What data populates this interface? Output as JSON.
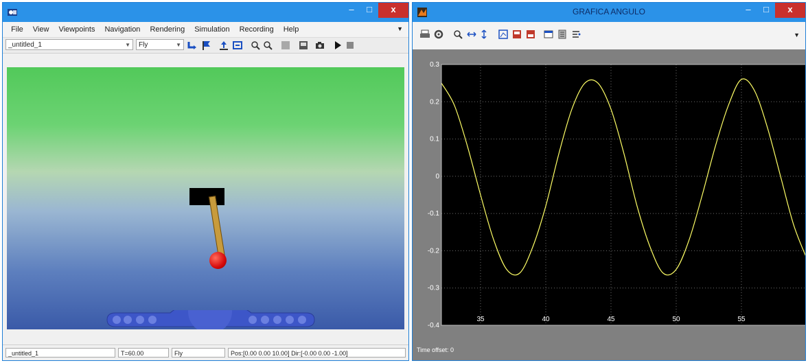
{
  "vr_window": {
    "menu": [
      "File",
      "View",
      "Viewpoints",
      "Navigation",
      "Rendering",
      "Simulation",
      "Recording",
      "Help"
    ],
    "world_combo": "_untitled_1",
    "nav_mode_combo": "Fly",
    "status": {
      "world": "_untitled_1",
      "time": "T=60.00",
      "mode": "Fly",
      "pos": "Pos:[0.00 0.00 10.00] Dir:[-0.00 0.00 -1.00]"
    }
  },
  "scope_window": {
    "title": "GRAFICA ANGULO",
    "time_offset_label": "Time offset:",
    "time_offset_value": "0"
  },
  "chart_data": {
    "type": "line",
    "title": "",
    "xlabel": "",
    "ylabel": "",
    "xlim": [
      32,
      60
    ],
    "ylim": [
      -0.4,
      0.3
    ],
    "xticks": [
      35,
      40,
      45,
      50,
      55
    ],
    "yticks": [
      0.3,
      0.2,
      0.1,
      0,
      -0.1,
      -0.2,
      -0.3,
      -0.4
    ],
    "ytick_labels": [
      "0.3",
      "0.2",
      "0.1",
      "0",
      "-0.1",
      "-0.2",
      "-0.3",
      "-0.4"
    ],
    "grid": true,
    "series": [
      {
        "color": "#ffff66",
        "x": [
          32,
          33,
          34,
          35,
          36,
          37,
          38,
          39,
          40,
          41,
          42,
          43,
          44,
          45,
          46,
          47,
          48,
          49,
          50,
          51,
          52,
          53,
          54,
          55,
          56,
          57,
          58,
          59,
          60
        ],
        "y": [
          0.25,
          0.19,
          0.08,
          -0.05,
          -0.17,
          -0.25,
          -0.26,
          -0.19,
          -0.08,
          0.06,
          0.18,
          0.25,
          0.25,
          0.18,
          0.06,
          -0.08,
          -0.19,
          -0.26,
          -0.25,
          -0.17,
          -0.05,
          0.08,
          0.19,
          0.26,
          0.23,
          0.13,
          0.0,
          -0.13,
          -0.22
        ]
      }
    ]
  }
}
